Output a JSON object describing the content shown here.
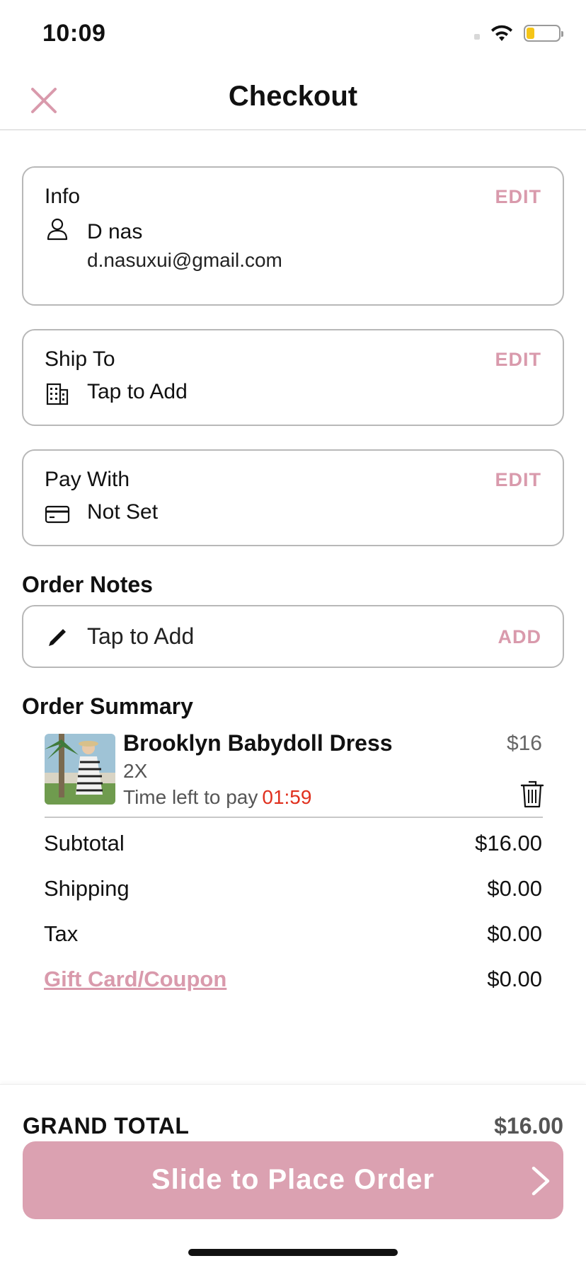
{
  "status_bar": {
    "time": "10:09",
    "battery_level": 0.25,
    "icons": [
      "signal-icon",
      "wifi-icon",
      "battery-icon"
    ]
  },
  "header": {
    "title": "Checkout",
    "close_icon": "close-icon"
  },
  "info_card": {
    "title": "Info",
    "edit_label": "EDIT",
    "name": "D nas",
    "email": "d.nasuxui@gmail.com",
    "icon": "person-icon"
  },
  "ship_card": {
    "title": "Ship To",
    "edit_label": "EDIT",
    "value": "Tap to Add",
    "icon": "building-icon"
  },
  "pay_card": {
    "title": "Pay With",
    "edit_label": "EDIT",
    "value": "Not Set",
    "icon": "credit-card-icon"
  },
  "order_notes": {
    "heading": "Order Notes",
    "placeholder": "Tap to Add",
    "add_label": "ADD",
    "icon": "pencil-icon"
  },
  "order_summary": {
    "heading": "Order Summary",
    "item": {
      "name": "Brooklyn Babydoll Dress",
      "size": "2X",
      "timer_label": "Time left to pay",
      "timer": "01:59",
      "price": "$16"
    },
    "rows": [
      {
        "label": "Subtotal",
        "value": "$16.00"
      },
      {
        "label": "Shipping",
        "value": "$0.00"
      },
      {
        "label": "Tax",
        "value": "$0.00"
      },
      {
        "label": "Gift Card/Coupon",
        "value": "$0.00"
      }
    ]
  },
  "footer": {
    "grand_total_label": "GRAND TOTAL",
    "grand_total_value": "$16.00",
    "slide_label": "Slide to Place Order"
  },
  "colors": {
    "accent": "#d99aac",
    "button": "#dba1b1",
    "timer": "#e0301e",
    "border": "#b8b8b8"
  }
}
